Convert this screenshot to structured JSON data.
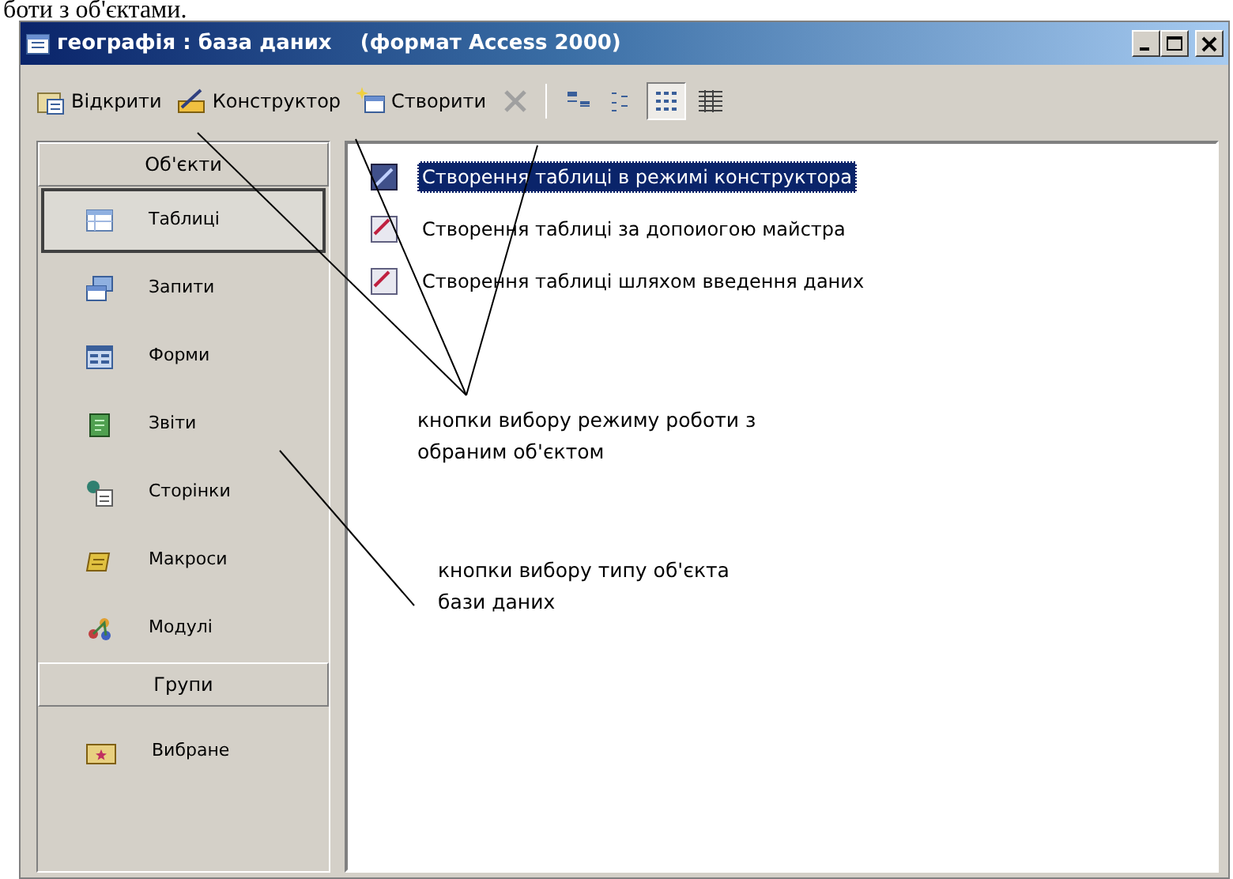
{
  "page_top_text": "боти з об'єктами.",
  "window": {
    "title": "географія : база даних    (формат Access 2000)"
  },
  "toolbar": {
    "commands": [
      {
        "label": "Відкрити"
      },
      {
        "label": "Конструктор"
      },
      {
        "label": "Створити"
      }
    ],
    "delete": {
      "disabled": true
    },
    "views": [
      {
        "selected": false
      },
      {
        "selected": false
      },
      {
        "selected": true
      },
      {
        "selected": false
      }
    ]
  },
  "sidebar": {
    "objects_header": "Об'єкти",
    "objects": [
      {
        "label": "Таблиці",
        "selected": true
      },
      {
        "label": "Запити",
        "selected": false
      },
      {
        "label": "Форми",
        "selected": false
      },
      {
        "label": "Звіти",
        "selected": false
      },
      {
        "label": "Сторінки",
        "selected": false
      },
      {
        "label": "Макроси",
        "selected": false
      },
      {
        "label": "Модулі",
        "selected": false
      }
    ],
    "groups_header": "Групи",
    "groups": [
      {
        "label": "Вибране",
        "selected": false
      }
    ]
  },
  "list": [
    {
      "label": "Створення таблиці в режимі конструктора",
      "selected": true
    },
    {
      "label": "Створення таблиці за допоиогою майстра",
      "selected": false
    },
    {
      "label": "Створення таблиці шляхом введення даних",
      "selected": false
    }
  ],
  "annotations": [
    {
      "text": "кнопки вибору режиму роботи з обраним об'єктом"
    },
    {
      "text": "кнопки вибору типу об'єкта бази даних"
    }
  ]
}
